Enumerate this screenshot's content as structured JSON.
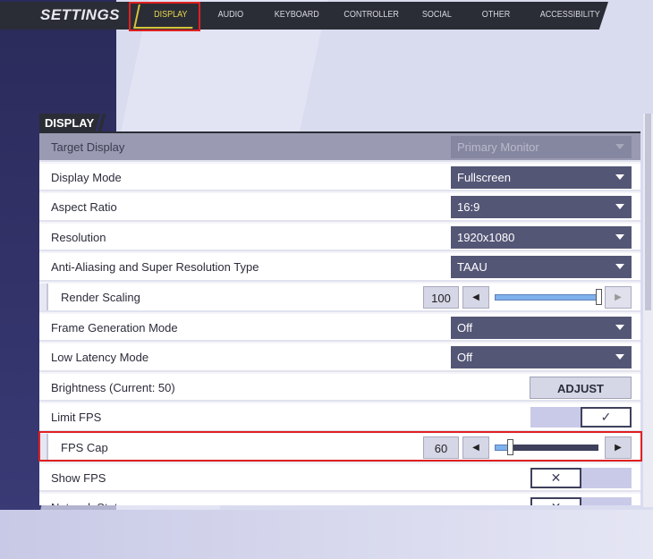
{
  "header": {
    "title": "SETTINGS",
    "tabs": [
      "DISPLAY",
      "AUDIO",
      "KEYBOARD",
      "CONTROLLER",
      "SOCIAL",
      "OTHER",
      "ACCESSIBILITY"
    ],
    "active_tab": "DISPLAY"
  },
  "section": {
    "title": "DISPLAY"
  },
  "colors": {
    "accent": "#e8d84a",
    "dropdown": "#545676",
    "highlight": "#e02020"
  },
  "rows": [
    {
      "label": "Target Display",
      "value": "Primary Monitor",
      "type": "dropdown",
      "disabled": true
    },
    {
      "label": "Display Mode",
      "value": "Fullscreen",
      "type": "dropdown"
    },
    {
      "label": "Aspect Ratio",
      "value": "16:9",
      "type": "dropdown"
    },
    {
      "label": "Resolution",
      "value": "1920x1080",
      "type": "dropdown"
    },
    {
      "label": "Anti-Aliasing and Super Resolution Type",
      "value": "TAAU",
      "type": "dropdown"
    },
    {
      "label": "Render Scaling",
      "value": "100",
      "type": "slider",
      "percent": 100
    },
    {
      "label": "Frame Generation Mode",
      "value": "Off",
      "type": "dropdown"
    },
    {
      "label": "Low Latency Mode",
      "value": "Off",
      "type": "dropdown"
    },
    {
      "label": "Brightness (Current: 50)",
      "value": "ADJUST",
      "type": "button"
    },
    {
      "label": "Limit FPS",
      "value": "✓",
      "type": "toggle",
      "on": true
    },
    {
      "label": "FPS Cap",
      "value": "60",
      "type": "slider",
      "percent": 15
    },
    {
      "label": "Show FPS",
      "value": "✕",
      "type": "toggle",
      "on": false
    },
    {
      "label": "Network Stats",
      "value": "✕",
      "type": "toggle",
      "on": false
    }
  ]
}
